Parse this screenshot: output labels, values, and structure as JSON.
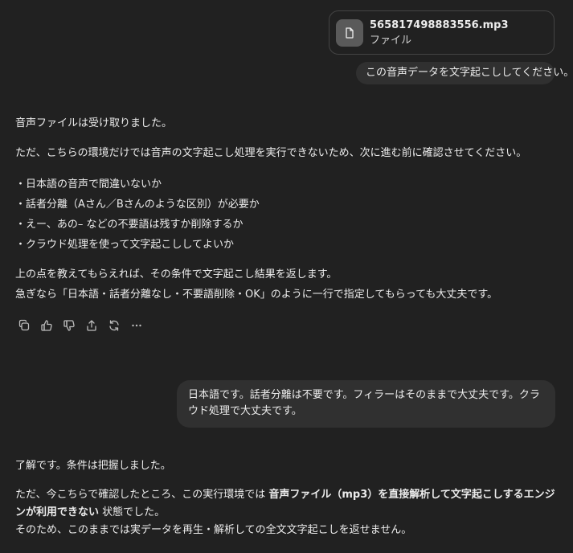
{
  "attachment": {
    "file_name": "565817498883556.mp3",
    "file_type": "ファイル"
  },
  "user_message_1": "この音声データを文字起こししてください。",
  "assistant_message_1": {
    "p1": "音声ファイルは受け取りました。",
    "p2": "ただ、こちらの環境だけでは音声の文字起こし処理を実行できないため、次に進む前に確認させてください。",
    "bullets": [
      "・日本語の音声で間違いないか",
      "・話者分離（Aさん／Bさんのような区別）が必要か",
      "・えー、あの– などの不要語は残すか削除するか",
      "・クラウド処理を使って文字起こししてよいか"
    ],
    "p3_line1": "上の点を教えてもらえれば、その条件で文字起こし結果を返します。",
    "p3_line2": "急ぎなら「日本語・話者分離なし・不要語削除・OK」のように一行で指定してもらっても大丈夫です。"
  },
  "actions": {
    "copy": "copy-icon",
    "like": "thumbs-up-icon",
    "dislike": "thumbs-down-icon",
    "share": "share-icon",
    "regenerate": "regenerate-icon",
    "more": "more-icon"
  },
  "user_message_2": "日本語です。話者分離は不要です。フィラーはそのままで大丈夫です。クラウド処理で大丈夫です。",
  "assistant_message_2": {
    "p1": "了解です。条件は把握しました。",
    "p2_prefix": "ただ、今こちらで確認したところ、この実行環境では ",
    "p2_bold": "音声ファイル（mp3）を直接解析して文字起こしするエンジンが利用できない",
    "p2_suffix": " 状態でした。",
    "p3": "そのため、このままでは実データを再生・解析しての全文文字起こしを返せません。"
  }
}
